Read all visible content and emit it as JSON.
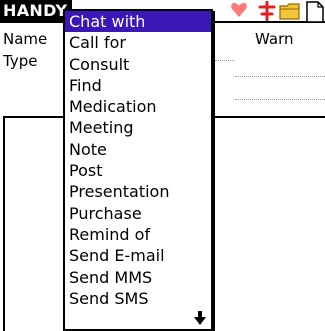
{
  "header": {
    "title": "HANDY",
    "icons": [
      "heart-icon",
      "cross-icon",
      "folder-icon",
      "page-icon"
    ]
  },
  "form": {
    "name_label": "Name",
    "type_label": "Type",
    "warn_label": "Warn"
  },
  "popup": {
    "selected_index": 0,
    "items": [
      "Chat with",
      "Call for",
      "Consult",
      "Find",
      "Medication",
      "Meeting",
      "Note",
      "Post",
      "Presentation",
      "Purchase",
      "Remind of",
      "Send E-mail",
      "Send MMS",
      "Send SMS"
    ],
    "scroll_icon": "scroll-down-arrow-icon"
  },
  "colors": {
    "selection": "#3c17b8",
    "heart": "#ff5a5a",
    "cross": "#e02020",
    "folder": "#f0c020"
  }
}
